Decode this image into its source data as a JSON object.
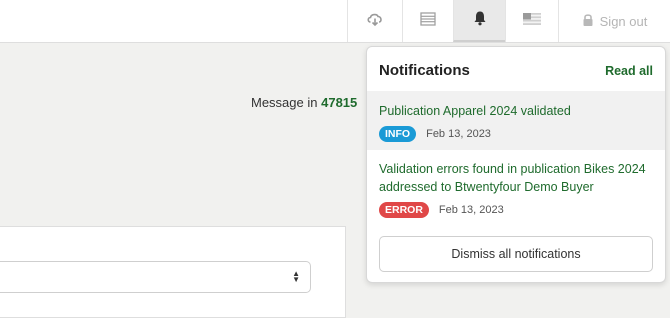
{
  "topbar": {
    "icons": [
      "cloud-download-icon",
      "list-icon",
      "bell-icon",
      "flag-icon",
      "lock-icon"
    ],
    "sign_out_label": "Sign out"
  },
  "message": {
    "prefix": "Message in",
    "code": "47815"
  },
  "notifications": {
    "title": "Notifications",
    "read_all_label": "Read all",
    "items": [
      {
        "title": "Publication Apparel 2024 validated",
        "badge": "INFO",
        "date": "Feb 13, 2023"
      },
      {
        "title": "Validation errors found in publication Bikes 2024 addressed to Btwentyfour Demo Buyer",
        "badge": "ERROR",
        "date": "Feb 13, 2023"
      }
    ],
    "dismiss_label": "Dismiss all notifications"
  },
  "colors": {
    "accent_green": "#1f6b2d",
    "info_badge": "#1a9ad6",
    "error_badge": "#e04848"
  }
}
